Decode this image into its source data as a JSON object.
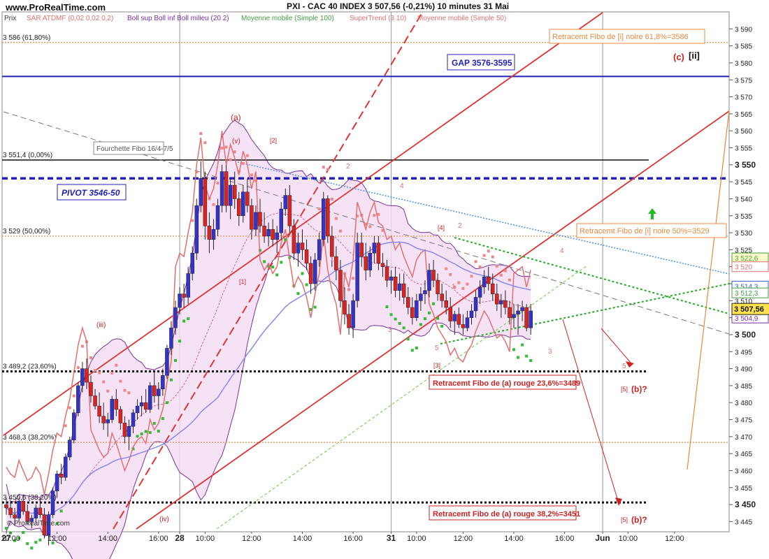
{
  "chart_data": {
    "type": "candlestick",
    "title": "PXI - CAC 40 INDEX   3 507,56 (-0,21%)   10 minutes  31 Mai",
    "header": {
      "prix": "Prix",
      "indicators": [
        {
          "label": "SAR ATDMF (0,02 0,02 0,2)",
          "color": "#e07070"
        },
        {
          "label": "Boll sup Boll inf Boll milieu (20 2)",
          "color": "#7a2fa0"
        },
        {
          "label": "Moyenne mobile (Simple 100)",
          "color": "#40a040"
        },
        {
          "label": "SuperTrend (3 10)",
          "color": "#e07070"
        },
        {
          "label": "Moyenne mobile (Simple 50)",
          "color": "#e07070"
        }
      ]
    },
    "watermark": "www.ProRealTime.com",
    "watermark_small": "© ProRealTime.com",
    "ylim": [
      3442,
      3595
    ],
    "y_ticks": [
      3445,
      3450,
      3455,
      3460,
      3465,
      3470,
      3475,
      3480,
      3485,
      3490,
      3495,
      3500,
      3505,
      3510,
      3515,
      3520,
      3525,
      3530,
      3535,
      3540,
      3545,
      3550,
      3555,
      3560,
      3565,
      3570,
      3575,
      3580,
      3585,
      3590
    ],
    "y_bold": [
      3450,
      3500,
      3550
    ],
    "x_labels": [
      {
        "t": 0,
        "label": "27",
        "bold": true
      },
      {
        "t": 1,
        "label": "10:00"
      },
      {
        "t": 12,
        "label": "12:00"
      },
      {
        "t": 24,
        "label": "14:00"
      },
      {
        "t": 36,
        "label": "16:00"
      },
      {
        "t": 41,
        "label": "28",
        "bold": true
      },
      {
        "t": 47,
        "label": "10:00"
      },
      {
        "t": 58,
        "label": "12:00"
      },
      {
        "t": 70,
        "label": "14:00"
      },
      {
        "t": 82,
        "label": "16:00"
      },
      {
        "t": 91,
        "label": "31",
        "bold": true
      },
      {
        "t": 97,
        "label": "10:00"
      },
      {
        "t": 108,
        "label": "12:00"
      },
      {
        "t": 120,
        "label": "14:00"
      },
      {
        "t": 132,
        "label": "16:00"
      },
      {
        "t": 141,
        "label": "Jun",
        "bold": true
      },
      {
        "t": 147,
        "label": "10:00"
      },
      {
        "t": 158,
        "label": "12:00"
      }
    ],
    "last_price": "3 507,56",
    "price_tags": [
      {
        "label": "3 522,6",
        "value": 3522.6,
        "color": "#40a040",
        "bg": "#ffffcc"
      },
      {
        "label": "3 520",
        "value": 3520,
        "color": "#e07070",
        "bg": "#ffffff"
      },
      {
        "label": "3 514,3",
        "value": 3514.3,
        "color": "#3060d0",
        "bg": "#ffffff"
      },
      {
        "label": "3 512,3",
        "value": 3512.3,
        "color": "#40a040",
        "bg": "#ffffff"
      },
      {
        "label": "3 504,9",
        "value": 3504.9,
        "color": "#7a2fa0",
        "bg": "#ffffff"
      }
    ],
    "horizontal_levels": [
      {
        "label": "3 586 (61,80%)",
        "value": 3586,
        "style": "dotted-orange"
      },
      {
        "label": "3 551,4 (0,00%)",
        "value": 3551.4,
        "style": "solid-black"
      },
      {
        "label": "3 529 (50,00%)",
        "value": 3529,
        "style": "dotted-orange"
      },
      {
        "label": "3 489,2 (23,60%)",
        "value": 3489.2,
        "style": "dotted-black"
      },
      {
        "label": "3 468,3 (38,20%)",
        "value": 3468.3,
        "style": "dotted-orange"
      },
      {
        "label": "3 450,6 (38,20%)",
        "value": 3450.6,
        "style": "dotted-black"
      }
    ],
    "gap_line": 3576,
    "pivot_line": 3546,
    "annotations": {
      "fourchette": "Fourchette Fibo 16/4-7/5",
      "gap": "GAP 3576-3595",
      "pivot": "PIVOT 3546-50",
      "fibo_618": "Retracemt Fibo de [i] noire 61,8%=3586",
      "fibo_50": "Retracemt Fibo de [i] noire 50%=3529",
      "fibo_236": "Retracemt Fibo de (a) rouge 23,6%=3489",
      "fibo_382": "Retracemt Fibo de (a) rouge 38,2%=3451",
      "wave_c": "(c)",
      "wave_ii": "[ii]",
      "wave_a": "(a)",
      "wave_v": "(v)",
      "wave_iii": "(iii)",
      "wave_iv": "(iv)",
      "wave_2b": "[2]",
      "wave_1b": "[1]",
      "wave_3b": "[3]",
      "wave_4b": "[4]",
      "wave_5b_1": "[5]",
      "wave_5b_2": "[5]",
      "wave_b_1": "(b)?",
      "wave_b_2": "(b)?",
      "small": [
        "1",
        "2",
        "3",
        "4",
        "5",
        "1",
        "2",
        "3",
        "4",
        "5",
        "2",
        "3",
        "4",
        "5"
      ]
    },
    "candles": [
      [
        3450,
        3452,
        3447,
        3449
      ],
      [
        3449,
        3451,
        3446,
        3447
      ],
      [
        3447,
        3449,
        3444,
        3446
      ],
      [
        3446,
        3452,
        3445,
        3451
      ],
      [
        3451,
        3453,
        3447,
        3448
      ],
      [
        3448,
        3450,
        3444,
        3445
      ],
      [
        3445,
        3447,
        3443,
        3446
      ],
      [
        3446,
        3450,
        3445,
        3449
      ],
      [
        3449,
        3452,
        3446,
        3447
      ],
      [
        3447,
        3449,
        3440,
        3441
      ],
      [
        3441,
        3448,
        3438,
        3447
      ],
      [
        3447,
        3455,
        3446,
        3454
      ],
      [
        3454,
        3460,
        3452,
        3459
      ],
      [
        3459,
        3462,
        3456,
        3458
      ],
      [
        3458,
        3465,
        3457,
        3464
      ],
      [
        3464,
        3470,
        3463,
        3469
      ],
      [
        3469,
        3478,
        3468,
        3477
      ],
      [
        3477,
        3486,
        3476,
        3485
      ],
      [
        3485,
        3492,
        3483,
        3490
      ],
      [
        3490,
        3493,
        3484,
        3486
      ],
      [
        3486,
        3488,
        3480,
        3482
      ],
      [
        3482,
        3484,
        3478,
        3479
      ],
      [
        3479,
        3483,
        3474,
        3476
      ],
      [
        3476,
        3480,
        3472,
        3474
      ],
      [
        3474,
        3477,
        3470,
        3475
      ],
      [
        3475,
        3482,
        3474,
        3481
      ],
      [
        3481,
        3484,
        3476,
        3478
      ],
      [
        3478,
        3479,
        3472,
        3474
      ],
      [
        3474,
        3476,
        3468,
        3470
      ],
      [
        3470,
        3475,
        3466,
        3473
      ],
      [
        3473,
        3478,
        3471,
        3477
      ],
      [
        3477,
        3481,
        3475,
        3479
      ],
      [
        3479,
        3482,
        3476,
        3480
      ],
      [
        3480,
        3484,
        3477,
        3478
      ],
      [
        3478,
        3486,
        3477,
        3485
      ],
      [
        3485,
        3489,
        3480,
        3482
      ],
      [
        3482,
        3486,
        3478,
        3484
      ],
      [
        3484,
        3490,
        3482,
        3488
      ],
      [
        3488,
        3497,
        3487,
        3496
      ],
      [
        3496,
        3504,
        3494,
        3502
      ],
      [
        3502,
        3510,
        3500,
        3508
      ],
      [
        3508,
        3514,
        3506,
        3512
      ],
      [
        3512,
        3515,
        3508,
        3511
      ],
      [
        3511,
        3520,
        3509,
        3518
      ],
      [
        3518,
        3526,
        3516,
        3524
      ],
      [
        3524,
        3540,
        3522,
        3538
      ],
      [
        3538,
        3551,
        3536,
        3546
      ],
      [
        3546,
        3548,
        3528,
        3532
      ],
      [
        3532,
        3536,
        3524,
        3528
      ],
      [
        3528,
        3534,
        3525,
        3531
      ],
      [
        3531,
        3540,
        3529,
        3538
      ],
      [
        3538,
        3550,
        3536,
        3548
      ],
      [
        3548,
        3550,
        3536,
        3538
      ],
      [
        3538,
        3546,
        3534,
        3544
      ],
      [
        3544,
        3548,
        3537,
        3540
      ],
      [
        3540,
        3542,
        3532,
        3535
      ],
      [
        3535,
        3544,
        3533,
        3542
      ],
      [
        3542,
        3546,
        3536,
        3538
      ],
      [
        3538,
        3540,
        3528,
        3531
      ],
      [
        3531,
        3538,
        3529,
        3536
      ],
      [
        3536,
        3540,
        3530,
        3532
      ],
      [
        3532,
        3536,
        3527,
        3529
      ],
      [
        3529,
        3533,
        3526,
        3531
      ],
      [
        3531,
        3534,
        3526,
        3528
      ],
      [
        3528,
        3532,
        3524,
        3530
      ],
      [
        3530,
        3539,
        3528,
        3537
      ],
      [
        3537,
        3543,
        3535,
        3541
      ],
      [
        3541,
        3544,
        3530,
        3532
      ],
      [
        3532,
        3534,
        3522,
        3524
      ],
      [
        3524,
        3530,
        3520,
        3527
      ],
      [
        3527,
        3531,
        3522,
        3525
      ],
      [
        3525,
        3528,
        3519,
        3521
      ],
      [
        3521,
        3523,
        3512,
        3515
      ],
      [
        3515,
        3524,
        3513,
        3522
      ],
      [
        3522,
        3530,
        3520,
        3528
      ],
      [
        3528,
        3542,
        3526,
        3540
      ],
      [
        3540,
        3541,
        3527,
        3529
      ],
      [
        3529,
        3532,
        3520,
        3523
      ],
      [
        3523,
        3526,
        3516,
        3519
      ],
      [
        3519,
        3522,
        3508,
        3510
      ],
      [
        3510,
        3514,
        3503,
        3506
      ],
      [
        3506,
        3509,
        3500,
        3502
      ],
      [
        3502,
        3512,
        3499,
        3510
      ],
      [
        3510,
        3530,
        3508,
        3527
      ],
      [
        3527,
        3530,
        3520,
        3523
      ],
      [
        3523,
        3527,
        3516,
        3519
      ],
      [
        3519,
        3526,
        3517,
        3524
      ],
      [
        3524,
        3529,
        3521,
        3527
      ],
      [
        3527,
        3529,
        3519,
        3521
      ],
      [
        3521,
        3524,
        3517,
        3520
      ],
      [
        3520,
        3522,
        3514,
        3516
      ],
      [
        3516,
        3519,
        3512,
        3517
      ],
      [
        3517,
        3520,
        3511,
        3513
      ],
      [
        3513,
        3518,
        3510,
        3515
      ],
      [
        3515,
        3518,
        3509,
        3511
      ],
      [
        3511,
        3514,
        3506,
        3508
      ],
      [
        3508,
        3511,
        3503,
        3505
      ],
      [
        3505,
        3512,
        3504,
        3510
      ],
      [
        3510,
        3514,
        3507,
        3512
      ],
      [
        3512,
        3516,
        3509,
        3513
      ],
      [
        3513,
        3521,
        3511,
        3519
      ],
      [
        3519,
        3522,
        3514,
        3516
      ],
      [
        3516,
        3518,
        3510,
        3512
      ],
      [
        3512,
        3515,
        3508,
        3510
      ],
      [
        3510,
        3513,
        3506,
        3508
      ],
      [
        3508,
        3511,
        3502,
        3504
      ],
      [
        3504,
        3507,
        3500,
        3506
      ],
      [
        3506,
        3508,
        3502,
        3503
      ],
      [
        3503,
        3506,
        3500,
        3502
      ],
      [
        3502,
        3507,
        3501,
        3505
      ],
      [
        3505,
        3509,
        3503,
        3507
      ],
      [
        3507,
        3513,
        3505,
        3511
      ],
      [
        3511,
        3516,
        3509,
        3514
      ],
      [
        3514,
        3519,
        3512,
        3517
      ],
      [
        3517,
        3520,
        3513,
        3515
      ],
      [
        3515,
        3518,
        3510,
        3512
      ],
      [
        3512,
        3515,
        3507,
        3509
      ],
      [
        3509,
        3512,
        3505,
        3510
      ],
      [
        3510,
        3513,
        3506,
        3508
      ],
      [
        3508,
        3510,
        3503,
        3505
      ],
      [
        3505,
        3509,
        3502,
        3506
      ],
      [
        3506,
        3509,
        3500,
        3507
      ],
      [
        3507,
        3510,
        3504,
        3508
      ],
      [
        3508,
        3509,
        3501,
        3502
      ],
      [
        3502,
        3509,
        3500,
        3507
      ]
    ]
  }
}
